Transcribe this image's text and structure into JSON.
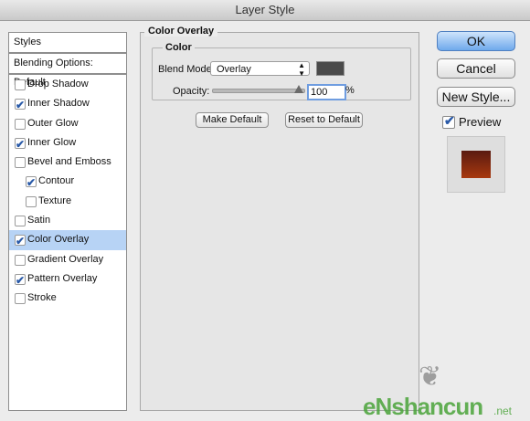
{
  "window": {
    "title": "Layer Style"
  },
  "styles_panel": {
    "header": "Styles",
    "blending_options": "Blending Options: Default",
    "items": [
      {
        "label": "Drop Shadow",
        "checked": false,
        "sub": false,
        "selected": false
      },
      {
        "label": "Inner Shadow",
        "checked": true,
        "sub": false,
        "selected": false
      },
      {
        "label": "Outer Glow",
        "checked": false,
        "sub": false,
        "selected": false
      },
      {
        "label": "Inner Glow",
        "checked": true,
        "sub": false,
        "selected": false
      },
      {
        "label": "Bevel and Emboss",
        "checked": false,
        "sub": false,
        "selected": false
      },
      {
        "label": "Contour",
        "checked": true,
        "sub": true,
        "selected": false
      },
      {
        "label": "Texture",
        "checked": false,
        "sub": true,
        "selected": false
      },
      {
        "label": "Satin",
        "checked": false,
        "sub": false,
        "selected": false
      },
      {
        "label": "Color Overlay",
        "checked": true,
        "sub": false,
        "selected": true
      },
      {
        "label": "Gradient Overlay",
        "checked": false,
        "sub": false,
        "selected": false
      },
      {
        "label": "Pattern Overlay",
        "checked": true,
        "sub": false,
        "selected": false
      },
      {
        "label": "Stroke",
        "checked": false,
        "sub": false,
        "selected": false
      }
    ]
  },
  "color_overlay": {
    "section_title": "Color Overlay",
    "group_title": "Color",
    "blend_mode_label": "Blend Mode:",
    "blend_mode_value": "Overlay",
    "overlay_color": "#4a4a4a",
    "opacity_label": "Opacity:",
    "opacity_value": "100",
    "opacity_unit": "%",
    "make_default": "Make Default",
    "reset_default": "Reset to Default"
  },
  "buttons": {
    "ok": "OK",
    "cancel": "Cancel",
    "new_style": "New Style..."
  },
  "preview": {
    "label": "Preview",
    "checked": true
  },
  "watermark": {
    "main": "eNshancun",
    "suffix": ".net"
  }
}
